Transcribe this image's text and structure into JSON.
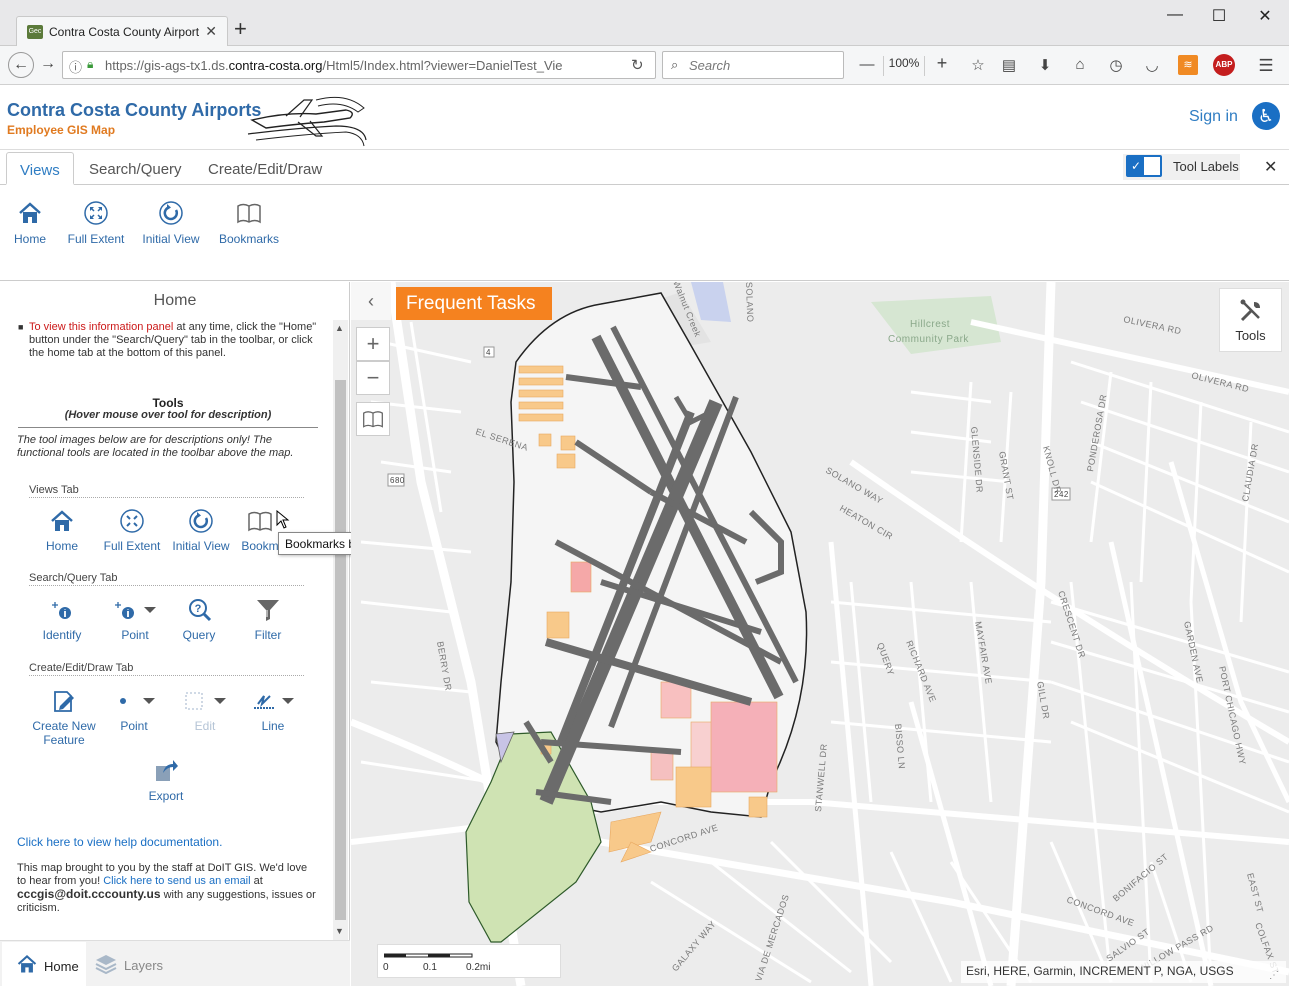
{
  "browser": {
    "tab_title": "Contra Costa County Airports",
    "favicon_text": "Gec",
    "url_prefix": "https://gis-ags-tx1.ds.",
    "url_domain": "contra-costa.org",
    "url_suffix": "/Html5/Index.html?viewer=DanielTest_Vie",
    "search_placeholder": "Search",
    "zoom": "100%"
  },
  "app": {
    "title": "Contra Costa County Airports",
    "subtitle": "Employee GIS Map",
    "sign_in": "Sign in"
  },
  "toolbar": {
    "tabs": [
      "Views",
      "Search/Query",
      "Create/Edit/Draw"
    ],
    "tool_labels": "Tool Labels",
    "views": [
      {
        "label": "Home",
        "icon": "home-icon"
      },
      {
        "label": "Full Extent",
        "icon": "full-extent-icon"
      },
      {
        "label": "Initial View",
        "icon": "initial-view-icon"
      },
      {
        "label": "Bookmarks",
        "icon": "bookmarks-icon"
      }
    ]
  },
  "panel": {
    "title": "Home",
    "intro_red": "To view this information panel",
    "intro_rest": " at any time, click the \"Home\" button under the \"Search/Query\" tab in the toolbar, or click the home tab at the bottom of this panel.",
    "tools_heading": "Tools",
    "tools_sub": "(Hover mouse over tool for description)",
    "tools_note": "The tool images below are for descriptions only! The functional tools are located in the toolbar above the map.",
    "views_tab": "Views Tab",
    "views_tools": [
      "Home",
      "Full Extent",
      "Initial View",
      "Bookm"
    ],
    "search_tab": "Search/Query Tab",
    "search_tools": [
      "Identify",
      "Point",
      "Query",
      "Filter"
    ],
    "create_tab": "Create/Edit/Draw Tab",
    "create_tools": [
      "Create New Feature",
      "Point",
      "Edit",
      "Line"
    ],
    "export": "Export",
    "help_link": "Click here to view help documentation.",
    "footer_1": "This map brought to you by the staff at DoIT GIS. We'd love to hear from you! ",
    "footer_link": "Click here to send us an email",
    "footer_2": " at ",
    "footer_email": "cccgis@doit.cccounty.us",
    "footer_3": " with any suggestions, issues or criticism.",
    "tooltip": "Bookmarks button: use this tool to access saved locations on the map",
    "bottom_tabs": [
      "Home",
      "Layers"
    ]
  },
  "map": {
    "frequent_tasks": "Frequent Tasks",
    "tools_label": "Tools",
    "scale_labels": [
      "0",
      "0.1",
      "0.2mi"
    ],
    "attribution": "Esri, HERE, Garmin, INCREMENT P, NGA, USGS",
    "street_labels": [
      "OLIVERA RD",
      "OLIVERA RD",
      "Hillcrest",
      "Community Park",
      "SOLANO WAY",
      "HEATON CIR",
      "CONCORD AVE",
      "CONCORD AVE",
      "BERRY DR",
      "STANWELL DR",
      "RICHARD AVE",
      "MAYFAIR AVE",
      "GLENSIDE DR",
      "GRANT ST",
      "KNOLL DR",
      "PONDEROSA DR",
      "CLAUDIA DR",
      "CRESCENT DR",
      "GARDEN AVE",
      "PORT CHICAGO HWY",
      "GALAXY WAY",
      "VIA DE MERCADOS",
      "BONIFACIO ST",
      "EAST ST",
      "COLFAX ST",
      "WILLOW PASS RD",
      "SALVIO ST",
      "QUERY",
      "BISSO LN",
      "GILL DR",
      "EL SERENA",
      "680",
      "242",
      "4",
      "Walnut Creek",
      "SOLANO"
    ]
  },
  "colors": {
    "accent": "#2f7dc3",
    "orange": "#f5821f",
    "title_blue": "#2f6aa8",
    "runway": "#6b6b6b",
    "building": "#f8c98a",
    "green_area": "#cfe3b3"
  }
}
